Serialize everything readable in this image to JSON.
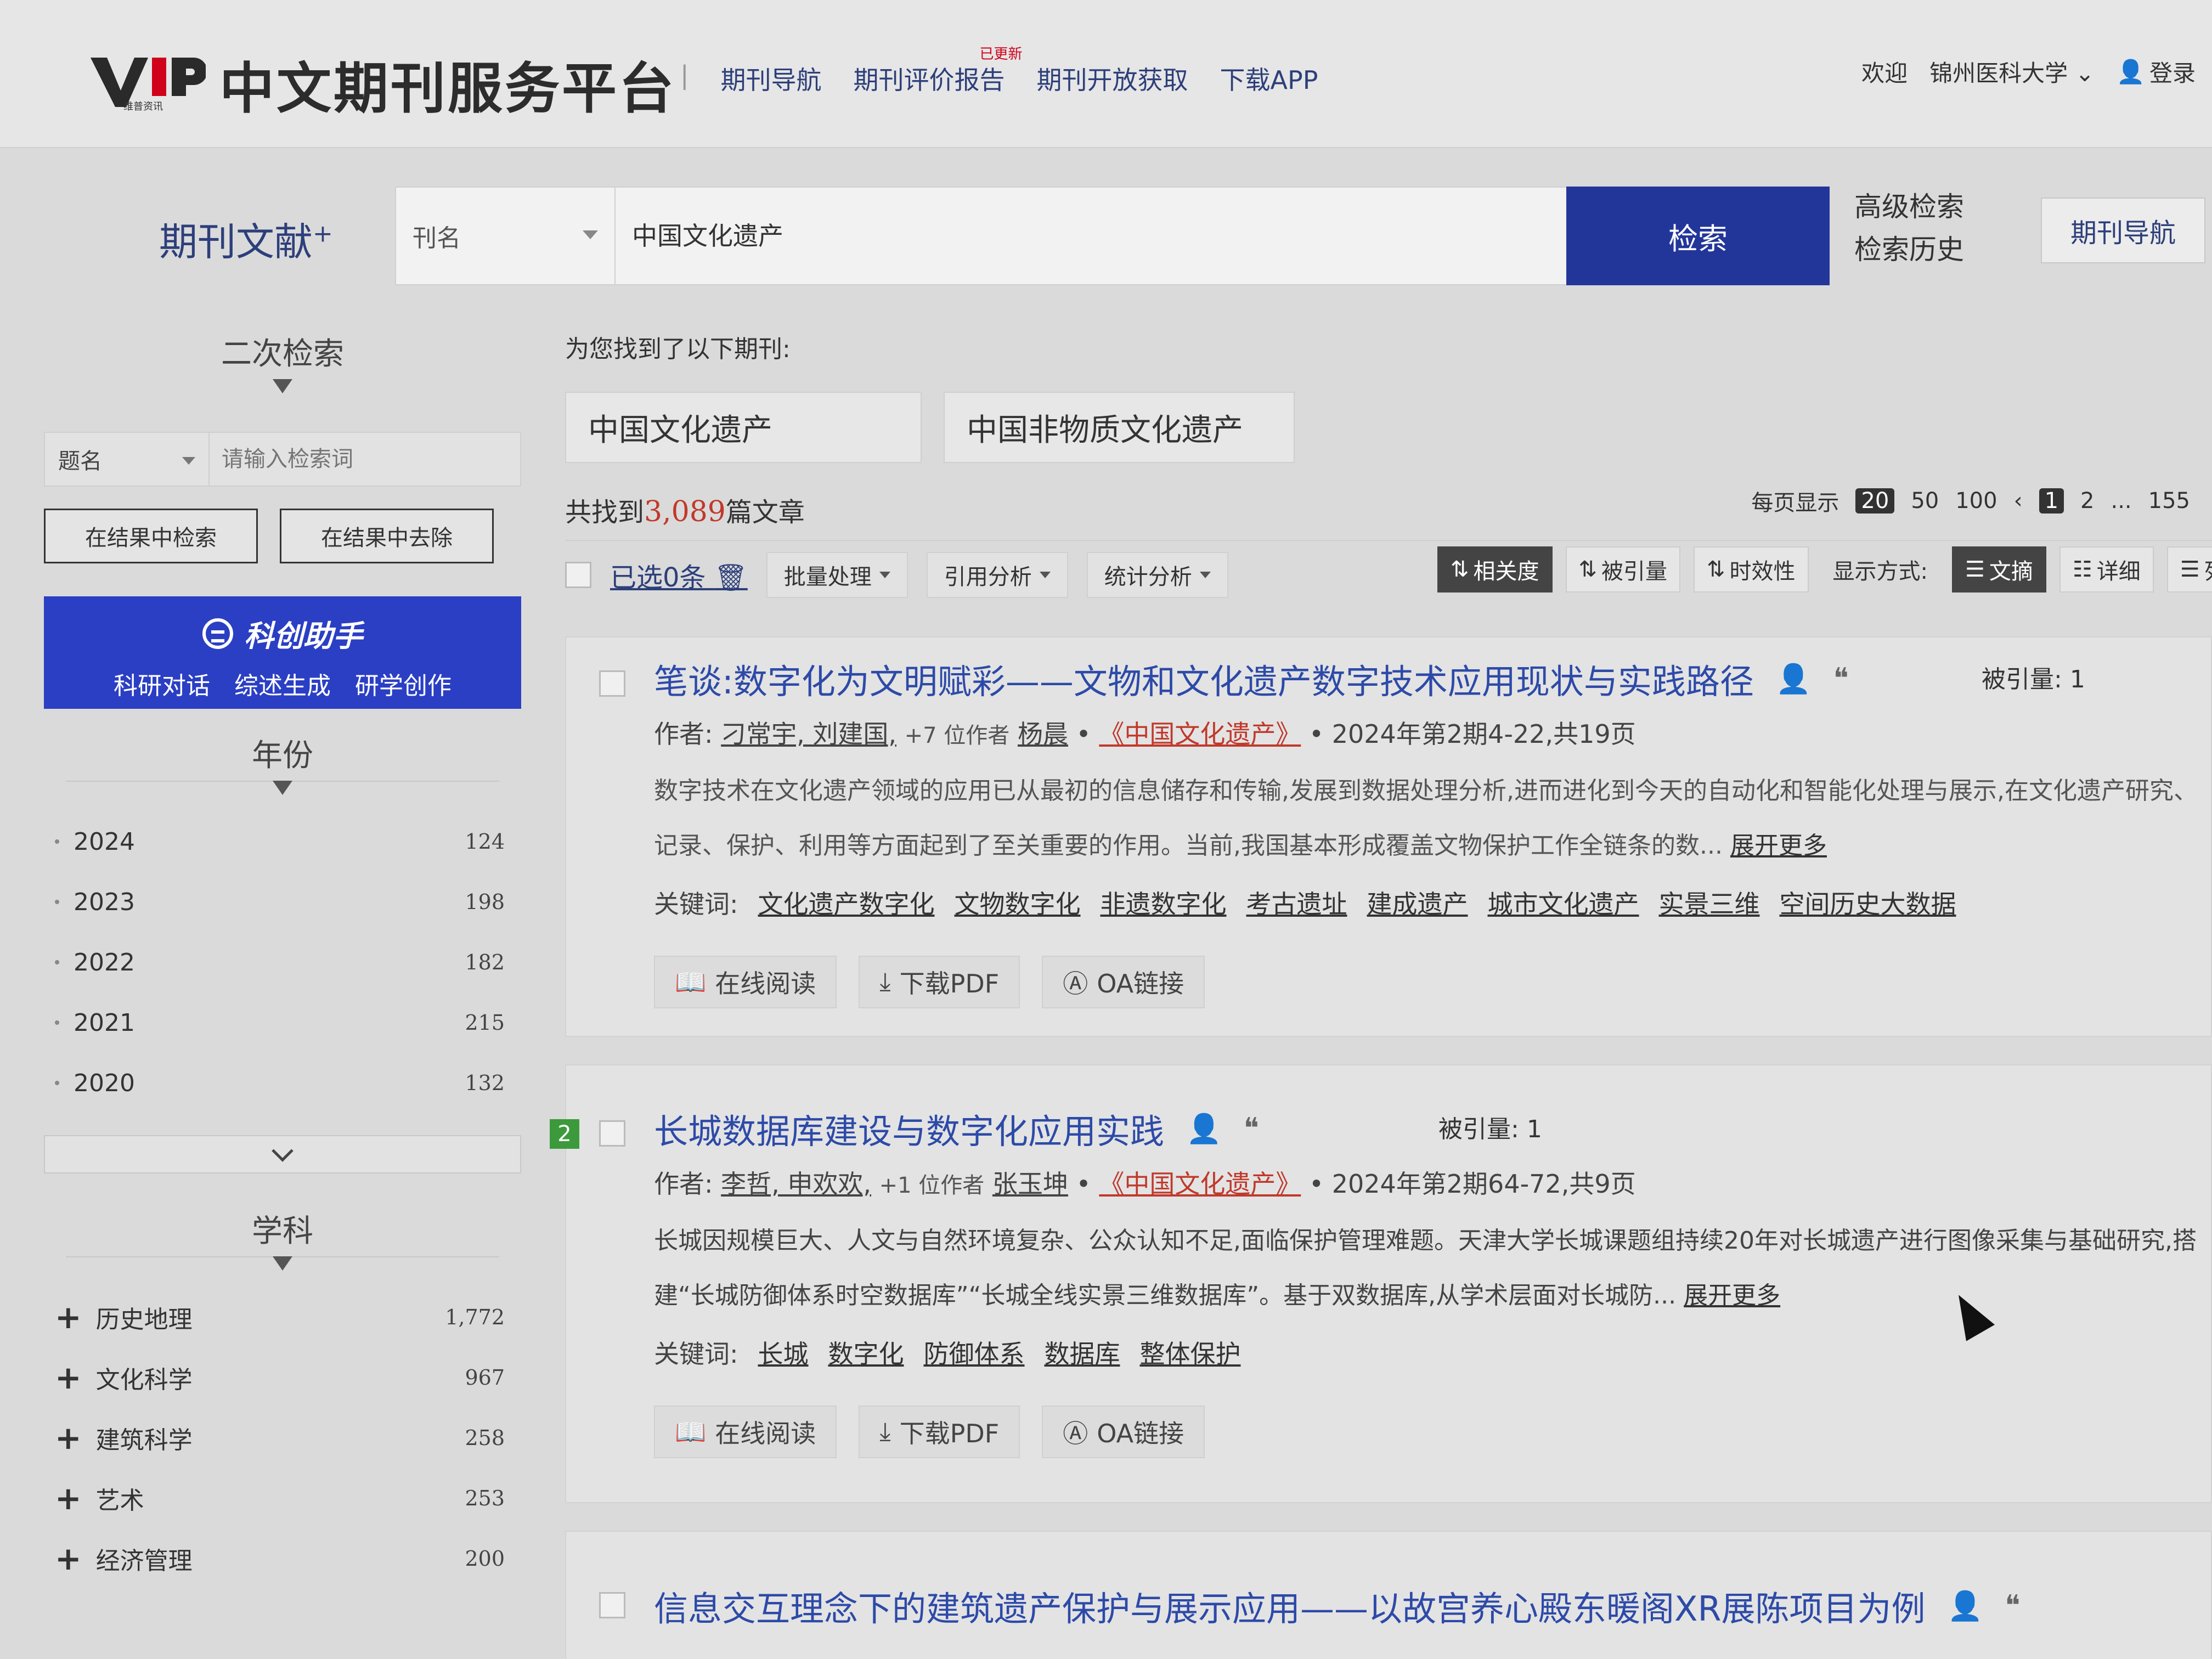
{
  "header": {
    "logo_text": "VIP",
    "logo_sub": "维普资讯",
    "brand": "中文期刊服务平台",
    "nav": [
      "期刊导航",
      "期刊评价报告",
      "期刊开放获取",
      "下载APP"
    ],
    "new_badge": "已更新",
    "welcome": "欢迎",
    "institution": "锦州医科大学",
    "login": "登录"
  },
  "search": {
    "doc_type": "期刊文献",
    "doc_type_sup": "+",
    "field": "刊名",
    "query": "中国文化遗产",
    "button": "检索",
    "advanced": "高级检索",
    "history": "检索历史",
    "journal_nav": "期刊导航"
  },
  "sidebar": {
    "secondary_title": "二次检索",
    "sec_field": "题名",
    "sec_placeholder": "请输入检索词",
    "btn_within": "在结果中检索",
    "btn_exclude": "在结果中去除",
    "assistant": {
      "title": "科创助手",
      "items": [
        "科研对话",
        "综述生成",
        "研学创作"
      ]
    },
    "year_title": "年份",
    "years": [
      {
        "label": "2024",
        "count": "124"
      },
      {
        "label": "2023",
        "count": "198"
      },
      {
        "label": "2022",
        "count": "182"
      },
      {
        "label": "2021",
        "count": "215"
      },
      {
        "label": "2020",
        "count": "132"
      }
    ],
    "subject_title": "学科",
    "subjects": [
      {
        "label": "历史地理",
        "count": "1,772"
      },
      {
        "label": "文化科学",
        "count": "967"
      },
      {
        "label": "建筑科学",
        "count": "258"
      },
      {
        "label": "艺术",
        "count": "253"
      },
      {
        "label": "经济管理",
        "count": "200"
      }
    ]
  },
  "main": {
    "found_journals": "为您找到了以下期刊:",
    "journals": [
      "中国文化遗产",
      "中国非物质文化遗产"
    ],
    "total_prefix": "共找到",
    "total": "3,089",
    "total_suffix": "篇文章",
    "per_page_label": "每页显示",
    "per_page": [
      "20",
      "50",
      "100"
    ],
    "pages": [
      "1",
      "2",
      "...",
      "155"
    ],
    "selected": "已选0条",
    "batch": "批量处理",
    "citation": "引用分析",
    "stats": "统计分析",
    "sort": [
      "相关度",
      "被引量",
      "时效性"
    ],
    "display_label": "显示方式:",
    "views": [
      "文摘",
      "详细",
      "列表"
    ]
  },
  "results": [
    {
      "title": "笔谈:数字化为文明赋彩——文物和文化遗产数字技术应用现状与实践路径",
      "cited_label": "被引量:",
      "cited": "1",
      "author_label": "作者:",
      "authors": "刁常宇, 刘建国,",
      "more_authors": "+7 位作者",
      "last_author": "杨晨",
      "journal": "《中国文化遗产》",
      "issue": "2024年第2期4-22,共19页",
      "abstract": "数字技术在文化遗产领域的应用已从最初的信息储存和传输,发展到数据处理分析,进而进化到今天的自动化和智能化处理与展示,在文化遗产研究、记录、保护、利用等方面起到了至关重要的作用。当前,我国基本形成覆盖文物保护工作全链条的数...",
      "expand": "展开更多",
      "kw_label": "关键词:",
      "keywords": [
        "文化遗产数字化",
        "文物数字化",
        "非遗数字化",
        "考古遗址",
        "建成遗产",
        "城市文化遗产",
        "实景三维",
        "空间历史大数据"
      ],
      "actions": [
        "在线阅读",
        "下载PDF",
        "OA链接"
      ]
    },
    {
      "num": "2",
      "title": "长城数据库建设与数字化应用实践",
      "cited_label": "被引量:",
      "cited": "1",
      "author_label": "作者:",
      "authors": "李哲, 申欢欢,",
      "more_authors": "+1 位作者",
      "last_author": "张玉坤",
      "journal": "《中国文化遗产》",
      "issue": "2024年第2期64-72,共9页",
      "abstract": "长城因规模巨大、人文与自然环境复杂、公众认知不足,面临保护管理难题。天津大学长城课题组持续20年对长城遗产进行图像采集与基础研究,搭建“长城防御体系时空数据库”“长城全线实景三维数据库”。基于双数据库,从学术层面对长城防...",
      "expand": "展开更多",
      "kw_label": "关键词:",
      "keywords": [
        "长城",
        "数字化",
        "防御体系",
        "数据库",
        "整体保护"
      ],
      "actions": [
        "在线阅读",
        "下载PDF",
        "OA链接"
      ]
    },
    {
      "title": "信息交互理念下的建筑遗产保护与展示应用——以故宫养心殿东暖阁XR展陈项目为例"
    }
  ],
  "colors": {
    "primary": "#22369a",
    "assistant": "#2b3fc4",
    "link": "#2d4aa8",
    "accent_red": "#c0392b"
  }
}
